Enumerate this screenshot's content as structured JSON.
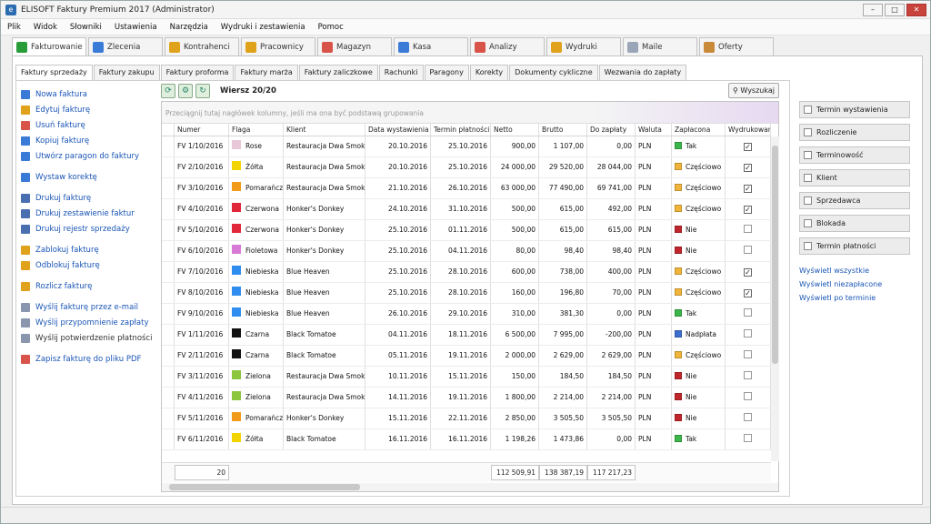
{
  "window": {
    "title": "ELISOFT Faktury Premium 2017 (Administrator)",
    "app_icon": "e"
  },
  "menu": [
    "Plik",
    "Widok",
    "Słowniki",
    "Ustawienia",
    "Narzędzia",
    "Wydruki i zestawienia",
    "Pomoc"
  ],
  "modules": [
    {
      "label": "Fakturowanie",
      "icon": "invoice-icon",
      "color": "#2a9d3b",
      "active": true
    },
    {
      "label": "Zlecenia",
      "icon": "orders-icon",
      "color": "#3b7bd8"
    },
    {
      "label": "Kontrahenci",
      "icon": "contractors-icon",
      "color": "#e0a21a"
    },
    {
      "label": "Pracownicy",
      "icon": "employees-icon",
      "color": "#e0a21a"
    },
    {
      "label": "Magazyn",
      "icon": "warehouse-icon",
      "color": "#d8544a"
    },
    {
      "label": "Kasa",
      "icon": "cash-icon",
      "color": "#3b7bd8"
    },
    {
      "label": "Analizy",
      "icon": "chart-icon",
      "color": "#d8544a"
    },
    {
      "label": "Wydruki",
      "icon": "printouts-icon",
      "color": "#e0a21a"
    },
    {
      "label": "Maile",
      "icon": "mail-icon",
      "color": "#9aa6b8"
    },
    {
      "label": "Oferty",
      "icon": "offers-icon",
      "color": "#c98a3a"
    }
  ],
  "subtabs": [
    "Faktury sprzedaży",
    "Faktury zakupu",
    "Faktury proforma",
    "Faktury marża",
    "Faktury zaliczkowe",
    "Rachunki",
    "Paragony",
    "Korekty",
    "Dokumenty cykliczne",
    "Wezwania do zapłaty"
  ],
  "actions": [
    {
      "label": "Nowa faktura",
      "icon": "new-invoice-icon",
      "color": "#3b7bd8"
    },
    {
      "label": "Edytuj fakturę",
      "icon": "edit-icon",
      "color": "#e0a21a"
    },
    {
      "label": "Usuń fakturę",
      "icon": "delete-icon",
      "color": "#d8544a"
    },
    {
      "label": "Kopiuj fakturę",
      "icon": "copy-icon",
      "color": "#3b7bd8"
    },
    {
      "label": "Utwórz paragon do faktury",
      "icon": "receipt-icon",
      "color": "#3b7bd8"
    },
    {
      "label": "Wystaw korektę",
      "icon": "correction-icon",
      "color": "#3b7bd8",
      "gap": true
    },
    {
      "label": "Drukuj fakturę",
      "icon": "print-icon",
      "color": "#4a6fb0",
      "gap": true
    },
    {
      "label": "Drukuj zestawienie faktur",
      "icon": "print-list-icon",
      "color": "#4a6fb0"
    },
    {
      "label": "Drukuj rejestr sprzedaży",
      "icon": "print-register-icon",
      "color": "#4a6fb0"
    },
    {
      "label": "Zablokuj fakturę",
      "icon": "lock-icon",
      "color": "#e0a21a",
      "gap": true
    },
    {
      "label": "Odblokuj fakturę",
      "icon": "unlock-icon",
      "color": "#e0a21a"
    },
    {
      "label": "Rozlicz fakturę",
      "icon": "coins-icon",
      "color": "#e0a21a",
      "gap": true
    },
    {
      "label": "Wyślij fakturę przez e-mail",
      "icon": "email-icon",
      "color": "#8a96ae",
      "gap": true
    },
    {
      "label": "Wyślij przypomnienie zapłaty",
      "icon": "reminder-mail-icon",
      "color": "#8a96ae"
    },
    {
      "label": "Wyślij potwierdzenie płatności",
      "icon": "confirm-mail-icon",
      "color": "#8a96ae",
      "black": true
    },
    {
      "label": "Zapisz fakturę do pliku PDF",
      "icon": "pdf-icon",
      "color": "#d8544a",
      "gap": true
    }
  ],
  "toolbar": {
    "row_info": "Wiersz 20/20",
    "search_label": "Wyszukaj"
  },
  "grid": {
    "group_hint": "Przeciągnij tutaj nagłówek kolumny, jeśli ma ona być podstawą grupowania",
    "columns": [
      "Numer",
      "Flaga",
      "Klient",
      "Data wystawienia",
      "Termin płatności",
      "Netto",
      "Brutto",
      "Do zapłaty",
      "Waluta",
      "Zapłacona",
      "Wydrukowana"
    ],
    "pay_colors": {
      "Tak": "#3cb54a",
      "Częściowo": "#f0b43a",
      "Nie": "#c0262b",
      "Nadpłata": "#3c6fd0"
    },
    "rows": [
      {
        "numer": "FV 1/10/2016",
        "flaga": "Rose",
        "flag_color": "#e8c7d8",
        "klient": "Restauracja Dwa Smoki",
        "data": "20.10.2016",
        "termin": "25.10.2016",
        "netto": "900,00",
        "brutto": "1 107,00",
        "do_zaplaty": "0,00",
        "waluta": "PLN",
        "zaplacona": "Tak",
        "wydrukowana": true
      },
      {
        "numer": "FV 2/10/2016",
        "flaga": "Żółta",
        "flag_color": "#f2d400",
        "klient": "Restauracja Dwa Smoki",
        "data": "20.10.2016",
        "termin": "25.10.2016",
        "netto": "24 000,00",
        "brutto": "29 520,00",
        "do_zaplaty": "28 044,00",
        "waluta": "PLN",
        "zaplacona": "Częściowo",
        "wydrukowana": true
      },
      {
        "numer": "FV 3/10/2016",
        "flaga": "Pomarańcz",
        "flag_color": "#f29b1a",
        "klient": "Restauracja Dwa Smoki",
        "data": "21.10.2016",
        "termin": "26.10.2016",
        "netto": "63 000,00",
        "brutto": "77 490,00",
        "do_zaplaty": "69 741,00",
        "waluta": "PLN",
        "zaplacona": "Częściowo",
        "wydrukowana": true
      },
      {
        "numer": "FV 4/10/2016",
        "flaga": "Czerwona",
        "flag_color": "#e0283a",
        "klient": "Honker's Donkey",
        "data": "24.10.2016",
        "termin": "31.10.2016",
        "netto": "500,00",
        "brutto": "615,00",
        "do_zaplaty": "492,00",
        "waluta": "PLN",
        "zaplacona": "Częściowo",
        "wydrukowana": true
      },
      {
        "numer": "FV 5/10/2016",
        "flaga": "Czerwona",
        "flag_color": "#e0283a",
        "klient": "Honker's Donkey",
        "data": "25.10.2016",
        "termin": "01.11.2016",
        "netto": "500,00",
        "brutto": "615,00",
        "do_zaplaty": "615,00",
        "waluta": "PLN",
        "zaplacona": "Nie",
        "wydrukowana": false
      },
      {
        "numer": "FV 6/10/2016",
        "flaga": "Fioletowa",
        "flag_color": "#d77ad6",
        "klient": "Honker's Donkey",
        "data": "25.10.2016",
        "termin": "04.11.2016",
        "netto": "80,00",
        "brutto": "98,40",
        "do_zaplaty": "98,40",
        "waluta": "PLN",
        "zaplacona": "Nie",
        "wydrukowana": false
      },
      {
        "numer": "FV 7/10/2016",
        "flaga": "Niebieska",
        "flag_color": "#2f8df0",
        "klient": "Blue Heaven",
        "data": "25.10.2016",
        "termin": "28.10.2016",
        "netto": "600,00",
        "brutto": "738,00",
        "do_zaplaty": "400,00",
        "waluta": "PLN",
        "zaplacona": "Częściowo",
        "wydrukowana": true
      },
      {
        "numer": "FV 8/10/2016",
        "flaga": "Niebieska",
        "flag_color": "#2f8df0",
        "klient": "Blue Heaven",
        "data": "25.10.2016",
        "termin": "28.10.2016",
        "netto": "160,00",
        "brutto": "196,80",
        "do_zaplaty": "70,00",
        "waluta": "PLN",
        "zaplacona": "Częściowo",
        "wydrukowana": true
      },
      {
        "numer": "FV 9/10/2016",
        "flaga": "Niebieska",
        "flag_color": "#2f8df0",
        "klient": "Blue Heaven",
        "data": "26.10.2016",
        "termin": "29.10.2016",
        "netto": "310,00",
        "brutto": "381,30",
        "do_zaplaty": "0,00",
        "waluta": "PLN",
        "zaplacona": "Tak",
        "wydrukowana": false
      },
      {
        "numer": "FV 1/11/2016",
        "flaga": "Czarna",
        "flag_color": "#111111",
        "klient": "Black Tomatoe",
        "data": "04.11.2016",
        "termin": "18.11.2016",
        "netto": "6 500,00",
        "brutto": "7 995,00",
        "do_zaplaty": "-200,00",
        "waluta": "PLN",
        "zaplacona": "Nadpłata",
        "wydrukowana": false
      },
      {
        "numer": "FV 2/11/2016",
        "flaga": "Czarna",
        "flag_color": "#111111",
        "klient": "Black Tomatoe",
        "data": "05.11.2016",
        "termin": "19.11.2016",
        "netto": "2 000,00",
        "brutto": "2 629,00",
        "do_zaplaty": "2 629,00",
        "waluta": "PLN",
        "zaplacona": "Częściowo",
        "wydrukowana": false
      },
      {
        "numer": "FV 3/11/2016",
        "flaga": "Zielona",
        "flag_color": "#8cc63f",
        "klient": "Restauracja Dwa Smoki",
        "data": "10.11.2016",
        "termin": "15.11.2016",
        "netto": "150,00",
        "brutto": "184,50",
        "do_zaplaty": "184,50",
        "waluta": "PLN",
        "zaplacona": "Nie",
        "wydrukowana": false
      },
      {
        "numer": "FV 4/11/2016",
        "flaga": "Zielona",
        "flag_color": "#8cc63f",
        "klient": "Restauracja Dwa Smoki",
        "data": "14.11.2016",
        "termin": "19.11.2016",
        "netto": "1 800,00",
        "brutto": "2 214,00",
        "do_zaplaty": "2 214,00",
        "waluta": "PLN",
        "zaplacona": "Nie",
        "wydrukowana": false
      },
      {
        "numer": "FV 5/11/2016",
        "flaga": "Pomarańcz",
        "flag_color": "#f29b1a",
        "klient": "Honker's Donkey",
        "data": "15.11.2016",
        "termin": "22.11.2016",
        "netto": "2 850,00",
        "brutto": "3 505,50",
        "do_zaplaty": "3 505,50",
        "waluta": "PLN",
        "zaplacona": "Nie",
        "wydrukowana": false
      },
      {
        "numer": "FV 6/11/2016",
        "flaga": "Żółta",
        "flag_color": "#f2d400",
        "klient": "Black Tomatoe",
        "data": "16.11.2016",
        "termin": "16.11.2016",
        "netto": "1 198,26",
        "brutto": "1 473,86",
        "do_zaplaty": "0,00",
        "waluta": "PLN",
        "zaplacona": "Tak",
        "wydrukowana": false
      }
    ],
    "footer": {
      "count": "20",
      "netto": "112 509,91",
      "brutto": "138 387,19",
      "do_zaplaty": "117 217,23"
    }
  },
  "filters": [
    "Termin wystawienia",
    "Rozliczenie",
    "Terminowość",
    "Klient",
    "Sprzedawca",
    "Blokada",
    "Termin płatności"
  ],
  "filter_links": [
    "Wyświetl wszystkie",
    "Wyświetl niezapłacone",
    "Wyświetl po terminie"
  ]
}
